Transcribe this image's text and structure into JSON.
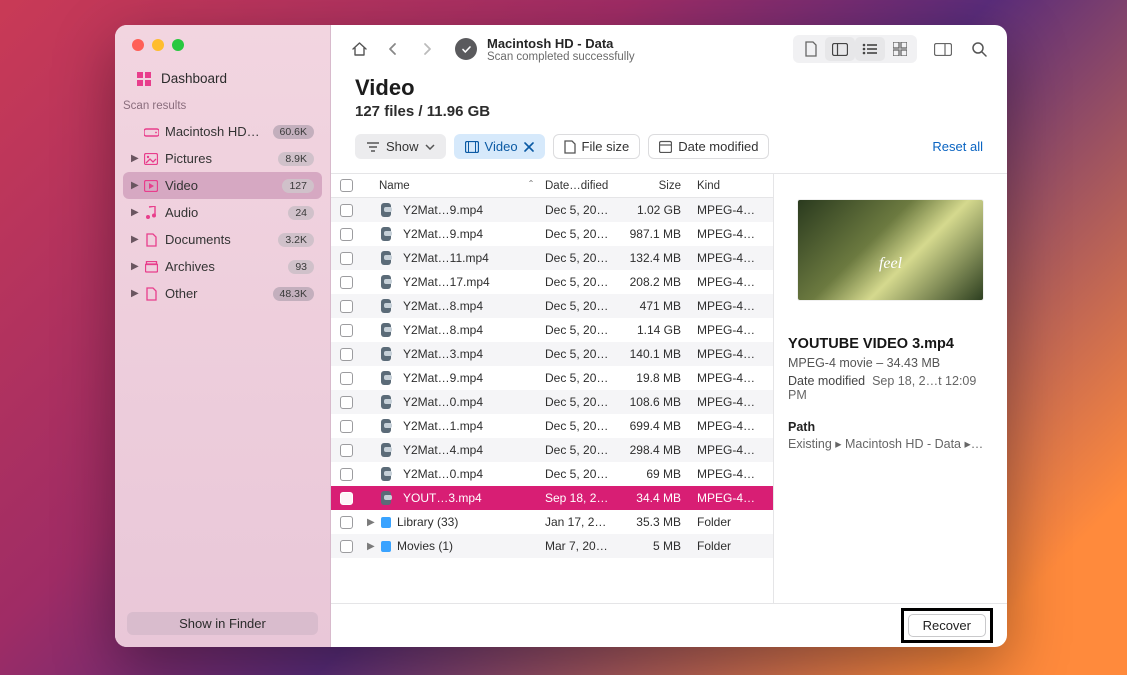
{
  "sidebar": {
    "dashboard_label": "Dashboard",
    "section_label": "Scan results",
    "disk": {
      "label": "Macintosh HD -…",
      "badge": "60.6K"
    },
    "items": [
      {
        "label": "Pictures",
        "badge": "8.9K"
      },
      {
        "label": "Video",
        "badge": "127",
        "selected": true
      },
      {
        "label": "Audio",
        "badge": "24"
      },
      {
        "label": "Documents",
        "badge": "3.2K"
      },
      {
        "label": "Archives",
        "badge": "93"
      },
      {
        "label": "Other",
        "badge": "48.3K"
      }
    ],
    "footer_button": "Show in Finder"
  },
  "toolbar": {
    "title": "Macintosh HD - Data",
    "subtitle": "Scan completed successfully"
  },
  "header": {
    "title": "Video",
    "subtitle": "127 files / 11.96 GB"
  },
  "filters": {
    "show": "Show",
    "video": "Video",
    "file_size": "File size",
    "date_modified": "Date modified",
    "reset": "Reset all"
  },
  "columns": {
    "name": "Name",
    "date": "Date…dified",
    "size": "Size",
    "kind": "Kind"
  },
  "rows": [
    {
      "type": "file",
      "name": "Y2Mat…9.mp4",
      "date": "Dec 5, 20…",
      "size": "1.02 GB",
      "kind": "MPEG-4…"
    },
    {
      "type": "file",
      "name": "Y2Mat…9.mp4",
      "date": "Dec 5, 20…",
      "size": "987.1 MB",
      "kind": "MPEG-4…"
    },
    {
      "type": "file",
      "name": "Y2Mat…11.mp4",
      "date": "Dec 5, 20…",
      "size": "132.4 MB",
      "kind": "MPEG-4…"
    },
    {
      "type": "file",
      "name": "Y2Mat…17.mp4",
      "date": "Dec 5, 20…",
      "size": "208.2 MB",
      "kind": "MPEG-4…"
    },
    {
      "type": "file",
      "name": "Y2Mat…8.mp4",
      "date": "Dec 5, 20…",
      "size": "471 MB",
      "kind": "MPEG-4…"
    },
    {
      "type": "file",
      "name": "Y2Mat…8.mp4",
      "date": "Dec 5, 20…",
      "size": "1.14 GB",
      "kind": "MPEG-4…"
    },
    {
      "type": "file",
      "name": "Y2Mat…3.mp4",
      "date": "Dec 5, 20…",
      "size": "140.1 MB",
      "kind": "MPEG-4…"
    },
    {
      "type": "file",
      "name": "Y2Mat…9.mp4",
      "date": "Dec 5, 20…",
      "size": "19.8 MB",
      "kind": "MPEG-4…"
    },
    {
      "type": "file",
      "name": "Y2Mat…0.mp4",
      "date": "Dec 5, 20…",
      "size": "108.6 MB",
      "kind": "MPEG-4…"
    },
    {
      "type": "file",
      "name": "Y2Mat…1.mp4",
      "date": "Dec 5, 20…",
      "size": "699.4 MB",
      "kind": "MPEG-4…"
    },
    {
      "type": "file",
      "name": "Y2Mat…4.mp4",
      "date": "Dec 5, 20…",
      "size": "298.4 MB",
      "kind": "MPEG-4…"
    },
    {
      "type": "file",
      "name": "Y2Mat…0.mp4",
      "date": "Dec 5, 20…",
      "size": "69 MB",
      "kind": "MPEG-4…"
    },
    {
      "type": "file",
      "name": "YOUT…3.mp4",
      "date": "Sep 18, 2…",
      "size": "34.4 MB",
      "kind": "MPEG-4…",
      "selected": true
    },
    {
      "type": "folder",
      "name": "Library (33)",
      "date": "Jan 17, 2…",
      "size": "35.3 MB",
      "kind": "Folder"
    },
    {
      "type": "folder",
      "name": "Movies (1)",
      "date": "Mar 7, 20…",
      "size": "5 MB",
      "kind": "Folder"
    }
  ],
  "details": {
    "name": "YOUTUBE VIDEO 3.mp4",
    "kind_size": "MPEG-4 movie – 34.43 MB",
    "date_label": "Date modified",
    "date_value": "Sep 18, 2…t 12:09 PM",
    "path_label": "Path",
    "path_value": "Existing ▸ Macintosh HD - Data ▸…"
  },
  "footer": {
    "recover": "Recover"
  }
}
